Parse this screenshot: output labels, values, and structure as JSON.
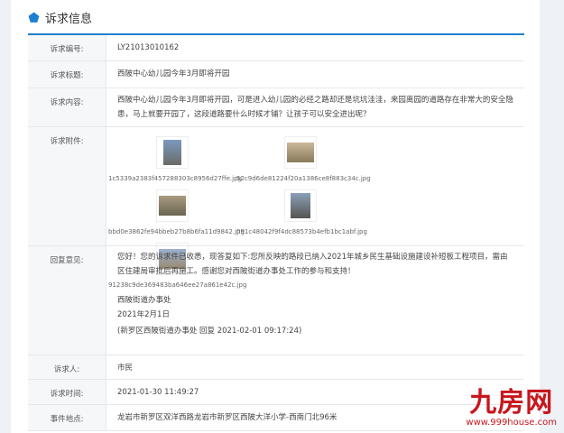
{
  "header": {
    "title": "诉求信息",
    "icon": "pentagon-icon",
    "accent": "#1e7fd0"
  },
  "rows": {
    "number": {
      "label": "诉求编号:",
      "value": "LY21013010162"
    },
    "subject": {
      "label": "诉求标题:",
      "value": "西陂中心幼儿园今年3月即将开园"
    },
    "content": {
      "label": "诉求内容:",
      "value": "西陂中心幼儿园今年3月即将开园，可是进入幼儿园的必经之路却还是坑坑洼洼，来园离园的道路存在非常大的安全隐患，马上就要开园了，这段道路要什么时候才铺？让孩子可以安全进出呢？"
    },
    "attachments": {
      "label": "诉求附件:",
      "files": [
        "1c5339a2383f457288303c8956d27ffe.jpg",
        "52c9d6de81224f20a1386ce8f883c34c.jpg",
        "bbd0e3862fe94bbeb27b8b6fa11d9842.jpg",
        "091c48042f9f4dc88573b4efb1bc1abf.jpg",
        "91238c9de369483ba646ee27a861e42c.jpg"
      ]
    },
    "reply": {
      "label": "回复意见:",
      "text": "您好！您的诉求件已收悉，现答复如下:您所反映的路段已纳入2021年城乡民生基础设施建设补短板工程项目，需由区住建局审批后再施工。感谢您对西陂街道办事处工作的参与和支持！",
      "org": "西陂街道办事处",
      "date": "2021年2月1日",
      "meta": "(新罗区西陂街道办事处 回复 2021-02-01 09:17:24)"
    },
    "petitioner": {
      "label": "诉求人:",
      "value": "市民"
    },
    "time": {
      "label": "诉求时间:",
      "value": "2021-01-30 11:49:27"
    },
    "location": {
      "label": "事件地点:",
      "value": "龙岩市新罗区双洋西路龙岩市新罗区西陂大洋小学-西南门北96米"
    }
  },
  "watermark": {
    "logo": "九房网",
    "url": "www.999house.com"
  }
}
